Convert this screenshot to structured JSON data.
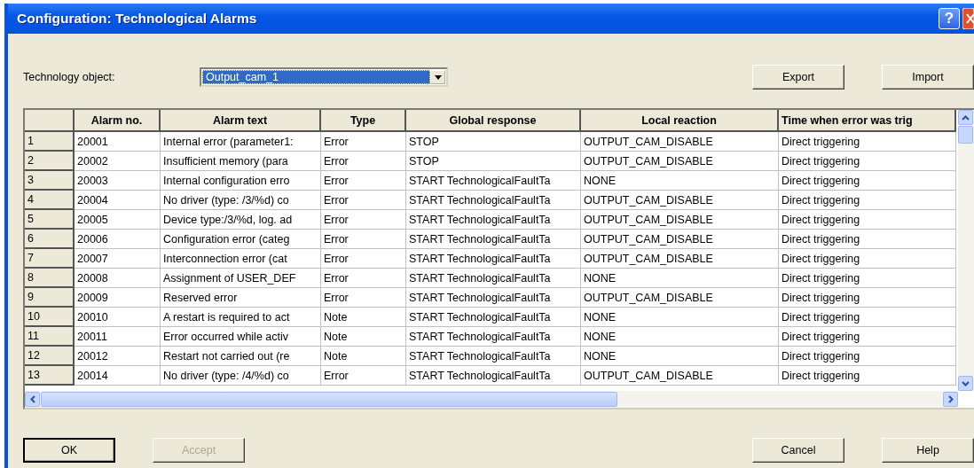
{
  "window": {
    "title": "Configuration: Technological Alarms",
    "help_button": "?"
  },
  "technology_object": {
    "label": "Technology object:",
    "value": "Output_cam_1"
  },
  "top_buttons": [
    {
      "label": "Export",
      "disabled": false
    },
    {
      "label": "Import",
      "disabled": false
    }
  ],
  "table": {
    "columns": [
      "Alarm no.",
      "Alarm text",
      "Type",
      "Global response",
      "Local reaction",
      "Time when error was trig"
    ],
    "rows": [
      {
        "index": "1",
        "cells": [
          "20001",
          "Internal error (parameter1:",
          "Error",
          "STOP",
          "OUTPUT_CAM_DISABLE",
          "Direct triggering"
        ]
      },
      {
        "index": "2",
        "cells": [
          "20002",
          "Insufficient memory (para",
          "Error",
          "STOP",
          "OUTPUT_CAM_DISABLE",
          "Direct triggering"
        ]
      },
      {
        "index": "3",
        "cells": [
          "20003",
          "Internal configuration erro",
          "Error",
          "START TechnologicalFaultTa",
          "NONE",
          "Direct triggering"
        ]
      },
      {
        "index": "4",
        "cells": [
          "20004",
          "No driver (type: /3/%d) co",
          "Error",
          "START TechnologicalFaultTa",
          "OUTPUT_CAM_DISABLE",
          "Direct triggering"
        ]
      },
      {
        "index": "5",
        "cells": [
          "20005",
          "Device type:/3/%d, log. ad",
          "Error",
          "START TechnologicalFaultTa",
          "OUTPUT_CAM_DISABLE",
          "Direct triggering"
        ]
      },
      {
        "index": "6",
        "cells": [
          "20006",
          "Configuration error (categ",
          "Error",
          "START TechnologicalFaultTa",
          "OUTPUT_CAM_DISABLE",
          "Direct triggering"
        ]
      },
      {
        "index": "7",
        "cells": [
          "20007",
          "Interconnection error (cat",
          "Error",
          "START TechnologicalFaultTa",
          "OUTPUT_CAM_DISABLE",
          "Direct triggering"
        ]
      },
      {
        "index": "8",
        "cells": [
          "20008",
          "Assignment of USER_DEF",
          "Error",
          "START TechnologicalFaultTa",
          "NONE",
          "Direct triggering"
        ]
      },
      {
        "index": "9",
        "cells": [
          "20009",
          "Reserved error",
          "Error",
          "START TechnologicalFaultTa",
          "OUTPUT_CAM_DISABLE",
          "Direct triggering"
        ]
      },
      {
        "index": "10",
        "cells": [
          "20010",
          "A restart is required to act",
          "Note",
          "START TechnologicalFaultTa",
          "NONE",
          "Direct triggering"
        ]
      },
      {
        "index": "11",
        "cells": [
          "20011",
          "Error occurred while activ",
          "Note",
          "START TechnologicalFaultTa",
          "NONE",
          "Direct triggering"
        ]
      },
      {
        "index": "12",
        "cells": [
          "20012",
          "Restart not carried out (re",
          "Note",
          "START TechnologicalFaultTa",
          "NONE",
          "Direct triggering"
        ]
      },
      {
        "index": "13",
        "cells": [
          "20014",
          "No driver (type: /4/%d) co",
          "Error",
          "START TechnologicalFaultTa",
          "OUTPUT_CAM_DISABLE",
          "Direct triggering"
        ]
      }
    ]
  },
  "bottom_buttons": [
    {
      "label": "OK",
      "disabled": false
    },
    {
      "label": "Accept",
      "disabled": true
    },
    {
      "label": "Cancel",
      "disabled": false
    },
    {
      "label": "Help",
      "disabled": false
    }
  ]
}
